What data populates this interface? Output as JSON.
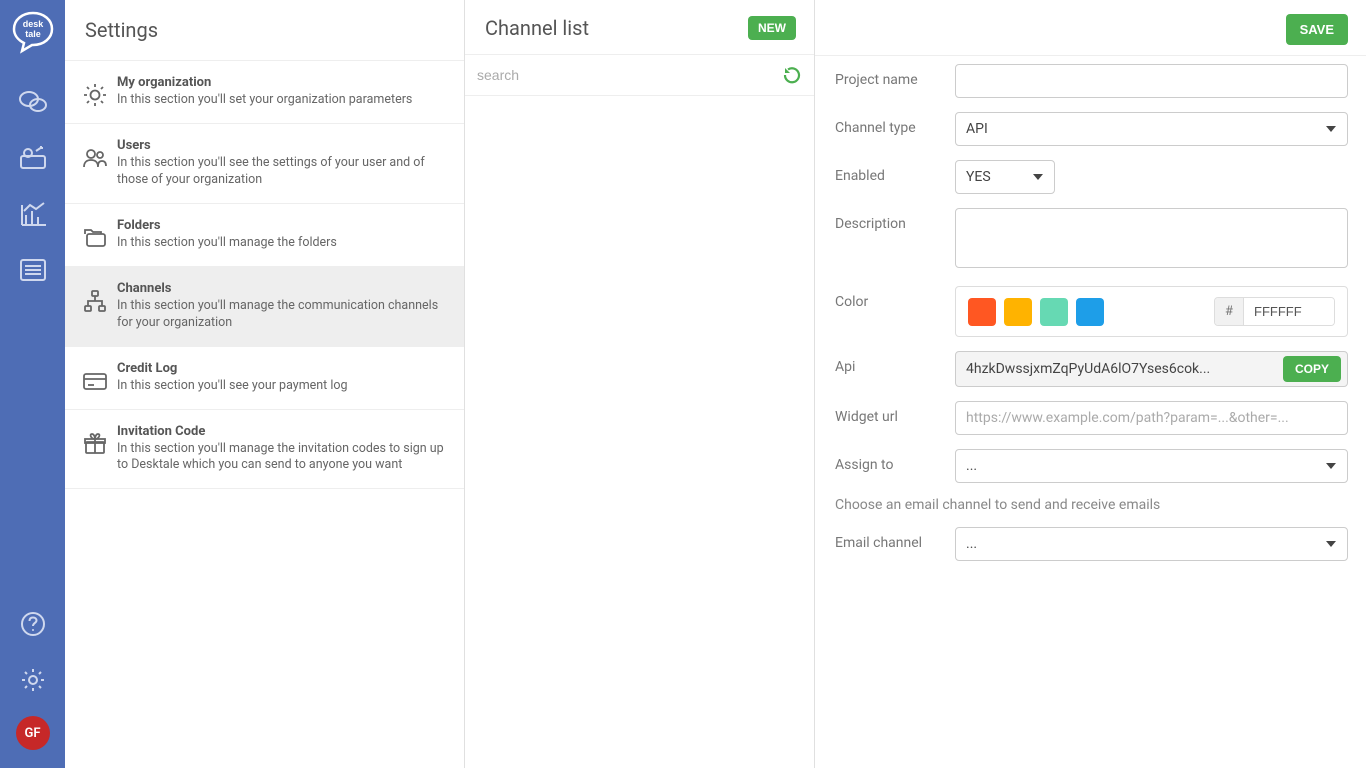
{
  "brand": {
    "name": "desk tale"
  },
  "nav": {
    "icons": [
      "chat",
      "dashboard",
      "analytics",
      "list"
    ],
    "bottom_icons": [
      "help",
      "settings"
    ],
    "avatar_initials": "GF"
  },
  "settings": {
    "title": "Settings",
    "items": [
      {
        "key": "org",
        "title": "My organization",
        "desc": "In this section you'll set your organization parameters",
        "active": false
      },
      {
        "key": "users",
        "title": "Users",
        "desc": "In this section you'll see the settings of your user and of those of your organization",
        "active": false
      },
      {
        "key": "folders",
        "title": "Folders",
        "desc": "In this section you'll manage the folders",
        "active": false
      },
      {
        "key": "channels",
        "title": "Channels",
        "desc": "In this section you'll manage the communication channels for your organization",
        "active": true
      },
      {
        "key": "credit",
        "title": "Credit Log",
        "desc": "In this section you'll see your payment log",
        "active": false
      },
      {
        "key": "invite",
        "title": "Invitation Code",
        "desc": "In this section you'll manage the invitation codes to sign up to Desktale which you can send to anyone you want",
        "active": false
      }
    ]
  },
  "channel_list": {
    "title": "Channel list",
    "new_label": "NEW",
    "search_placeholder": "search"
  },
  "form": {
    "save_label": "SAVE",
    "labels": {
      "project_name": "Project name",
      "channel_type": "Channel type",
      "enabled": "Enabled",
      "description": "Description",
      "color": "Color",
      "api": "Api",
      "widget_url": "Widget url",
      "assign_to": "Assign to",
      "email_channel": "Email channel"
    },
    "values": {
      "project_name": "",
      "channel_type": "API",
      "enabled": "YES",
      "description": "",
      "color_hex": "FFFFFF",
      "api_key": "4hzkDwssjxmZqPyUdA6lO7Yses6cok...",
      "widget_url": "",
      "assign_to": "...",
      "email_channel": "..."
    },
    "placeholders": {
      "widget_url": "https://www.example.com/path?param=...&other=..."
    },
    "copy_label": "COPY",
    "hash_label": "#",
    "email_hint": "Choose an email channel to send and receive emails",
    "swatch_colors": [
      "#ff5722",
      "#ffb300",
      "#66d9b3",
      "#1e9ee8"
    ]
  }
}
